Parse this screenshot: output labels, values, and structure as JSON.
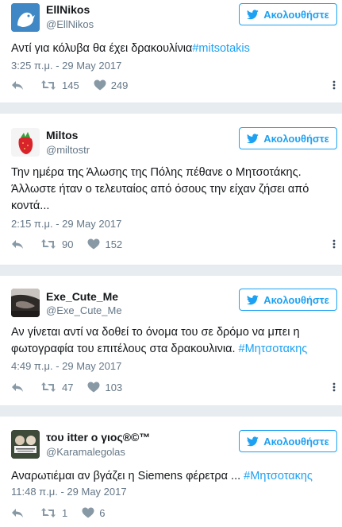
{
  "follow_label": "Ακολουθήστε",
  "tweets": [
    {
      "name": "EllNikos",
      "handle": "@EllNikos",
      "text": "Αντί για κόλυβα θα έχει δρακουλίνια",
      "hashtag": "#mitsotakis",
      "time": "3:25 π.μ. - 29 May 2017",
      "retweets": "145",
      "likes": "249"
    },
    {
      "name": "Miltos",
      "handle": "@miltostr",
      "text": "Την ημέρα της Άλωσης της Πόλης πέθανε ο Μητσοτάκης. Άλλωστε ήταν ο τελευταίος από όσους την είχαν ζήσει από κοντά...",
      "hashtag": "",
      "time": "2:15 π.μ. - 29 May 2017",
      "retweets": "90",
      "likes": "152"
    },
    {
      "name": "Exe_Cute_Me",
      "handle": "@Exe_Cute_Me",
      "text": "Αν γίνεται αντί να δοθεί το όνομα του σε δρόμο να μπει η φωτογραφία του επιτέλους στα δρακουλινια. ",
      "hashtag": "#Μητσοτακης",
      "time": "4:49 π.μ. - 29 May 2017",
      "retweets": "47",
      "likes": "103"
    },
    {
      "name": "του itter ο γιος®©™",
      "handle": "@Karamalegolas",
      "text": "Αναρωτιέμαι αν βγάζει η Siemens φέρετρα ... ",
      "hashtag": "#Μητσοτακης",
      "time": "11:48 π.μ. - 29 May 2017",
      "retweets": "1",
      "likes": "6"
    }
  ],
  "colors": {
    "accent": "#1da1f2",
    "muted": "#657786",
    "text": "#14171a",
    "background": "#e6ecf0"
  }
}
